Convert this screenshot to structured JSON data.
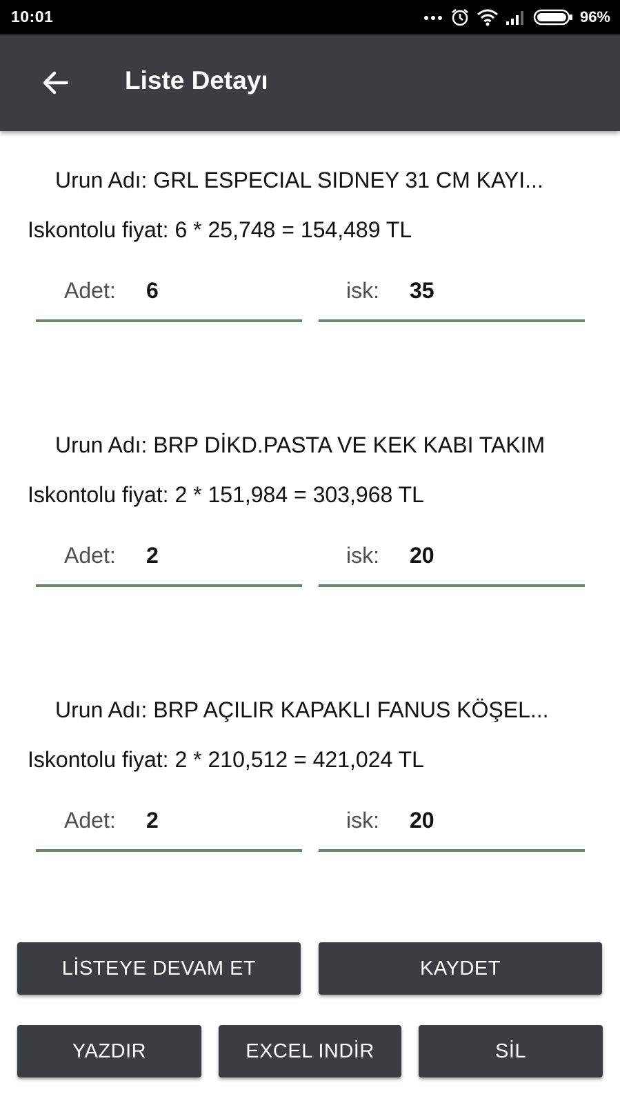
{
  "status_bar": {
    "time": "10:01",
    "battery_percent": "96%",
    "icons": [
      "more-dots-icon",
      "alarm-icon",
      "wifi-icon",
      "signal-icon",
      "battery-icon"
    ]
  },
  "app_bar": {
    "title": "Liste Detayı",
    "back_icon": "arrow-back-icon"
  },
  "items": [
    {
      "name": "Urun Adı: GRL ESPECIAL SIDNEY 31 CM KAYI...",
      "price": "Iskontolu fiyat: 6 * 25,748 = 154,489 TL",
      "adet_label": "Adet:",
      "adet_value": "6",
      "isk_label": "isk:",
      "isk_value": "35"
    },
    {
      "name": "Urun Adı: BRP DİKD.PASTA VE KEK KABI TAKIM",
      "price": "Iskontolu fiyat: 2 * 151,984 = 303,968 TL",
      "adet_label": "Adet:",
      "adet_value": "2",
      "isk_label": "isk:",
      "isk_value": "20"
    },
    {
      "name": "Urun Adı: BRP AÇILIR KAPAKLI FANUS KÖŞEL...",
      "price": "Iskontolu fiyat: 2 * 210,512 = 421,024 TL",
      "adet_label": "Adet:",
      "adet_value": "2",
      "isk_label": "isk:",
      "isk_value": "20"
    }
  ],
  "buttons": {
    "continue_list": "LİSTEYE DEVAM ET",
    "save": "KAYDET",
    "print": "YAZDIR",
    "excel_download": "EXCEL INDİR",
    "delete": "SİL"
  },
  "colors": {
    "app_bar": "#3c3d42",
    "field_underline": "#6a8571",
    "button": "#3c3d42"
  }
}
